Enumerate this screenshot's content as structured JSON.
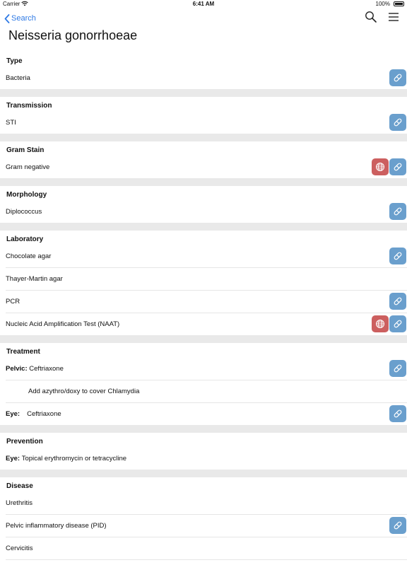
{
  "status": {
    "carrier": "Carrier",
    "time": "6:41 AM",
    "battery": "100%"
  },
  "nav": {
    "back_label": "Search"
  },
  "title": "Neisseria gonorrhoeae",
  "sections": {
    "type": {
      "header": "Type",
      "rows": [
        "Bacteria"
      ]
    },
    "transmission": {
      "header": "Transmission",
      "rows": [
        "STI"
      ]
    },
    "gram": {
      "header": "Gram Stain",
      "rows": [
        "Gram negative"
      ]
    },
    "morphology": {
      "header": "Morphology",
      "rows": [
        "Diplococcus"
      ]
    },
    "laboratory": {
      "header": "Laboratory",
      "rows": [
        "Chocolate agar",
        "Thayer-Martin agar",
        "PCR",
        "Nucleic Acid Amplification Test (NAAT)"
      ]
    },
    "treatment": {
      "header": "Treatment",
      "pelvic_label": "Pelvic:",
      "pelvic_value": "Ceftriaxone",
      "pelvic_note": "Add azythro/doxy to cover Chlamydia",
      "eye_label": "Eye:",
      "eye_value": "Ceftriaxone"
    },
    "prevention": {
      "header": "Prevention",
      "eye_label": "Eye:",
      "eye_value": "Topical erythromycin or tetracycline"
    },
    "disease": {
      "header": "Disease",
      "rows": [
        "Urethritis",
        "Pelvic inflammatory disease (PID)",
        "Cervicitis"
      ]
    }
  },
  "colors": {
    "accent": "#2f7ae5",
    "pill_button": "#6a9fcd",
    "globe_button": "#cc5f5f",
    "divider": "#e9e9e9"
  }
}
